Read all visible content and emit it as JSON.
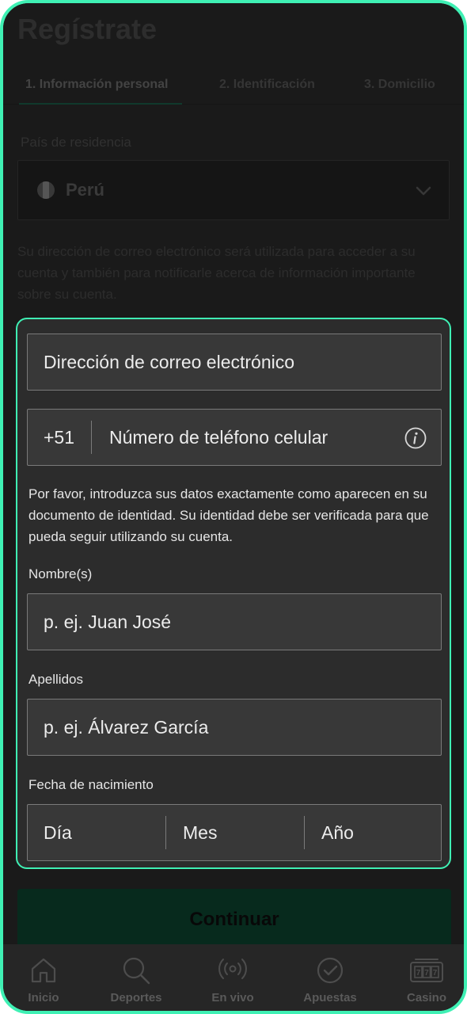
{
  "page": {
    "title": "Regístrate",
    "tabs": [
      {
        "label": "1. Información personal",
        "active": true
      },
      {
        "label": "2. Identificación",
        "active": false
      },
      {
        "label": "3. Domicilio",
        "active": false
      }
    ]
  },
  "country": {
    "label": "País de residencia",
    "value": "Perú",
    "flag_icon": "peru-flag-icon"
  },
  "info_text": "Su dirección de correo electrónico será utilizada para acceder a su cuenta y también para notificarle acerca de información importante sobre su cuenta.",
  "form": {
    "email_placeholder": "Dirección de correo electrónico",
    "phone_prefix": "+51",
    "phone_placeholder": "Número de teléfono celular",
    "identity_note": "Por favor, introduzca sus datos exactamente como aparecen en su documento de identidad. Su identidad debe ser verificada para que pueda seguir utilizando su cuenta.",
    "first_name_label": "Nombre(s)",
    "first_name_placeholder": "p. ej. Juan José",
    "last_name_label": "Apellidos",
    "last_name_placeholder": "p. ej. Álvarez García",
    "dob_label": "Fecha de nacimiento",
    "dob_day": "Día",
    "dob_month": "Mes",
    "dob_year": "Año"
  },
  "continue_label": "Continuar",
  "nav": [
    {
      "label": "Inicio",
      "icon": "home-icon"
    },
    {
      "label": "Deportes",
      "icon": "search-icon"
    },
    {
      "label": "En vivo",
      "icon": "live-icon"
    },
    {
      "label": "Apuestas",
      "icon": "check-circle-icon"
    },
    {
      "label": "Casino",
      "icon": "slot-machine-icon"
    }
  ],
  "colors": {
    "accent": "#3ff0b4",
    "background": "#2b2b2b",
    "field_bg": "#383838",
    "continue_bg": "#0c4530"
  }
}
